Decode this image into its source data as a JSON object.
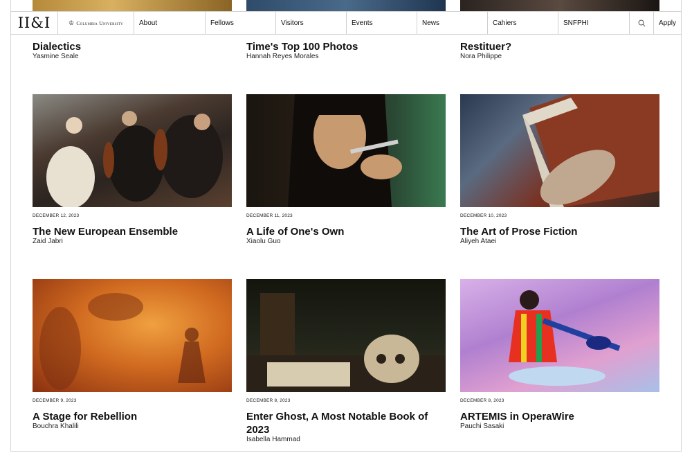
{
  "nav": {
    "logo": "II&I",
    "university": "Columbia University",
    "items": [
      "About",
      "Fellows",
      "Visitors",
      "Events",
      "News",
      "Cahiers",
      "SNFPHI"
    ],
    "search_icon": "search-icon",
    "apply_label": "Apply"
  },
  "top_row": [
    {
      "title": "Dialectics",
      "author": "Yasmine Seale"
    },
    {
      "title": "Time's Top 100 Photos",
      "author": "Hannah Reyes Morales"
    },
    {
      "title": "Restituer?",
      "author": "Nora Philippe"
    }
  ],
  "row2": [
    {
      "date": "December 12, 2023",
      "title": "The New European Ensemble",
      "author": "Zaid Jabri"
    },
    {
      "date": "December 11, 2023",
      "title": "A Life of One's Own",
      "author": "Xiaolu Guo"
    },
    {
      "date": "December 10, 2023",
      "title": "The Art of Prose Fiction",
      "author": "Aliyeh Ataei"
    }
  ],
  "row3": [
    {
      "date": "December 9, 2023",
      "title": "A Stage for Rebellion",
      "author": "Bouchra Khalili"
    },
    {
      "date": "December 8, 2023",
      "title": "Enter Ghost, A Most Notable Book of 2023",
      "author": "Isabella Hammad"
    },
    {
      "date": "December 8, 2023",
      "title": "ARTEMIS in OperaWire",
      "author": "Pauchi Sasaki"
    }
  ]
}
